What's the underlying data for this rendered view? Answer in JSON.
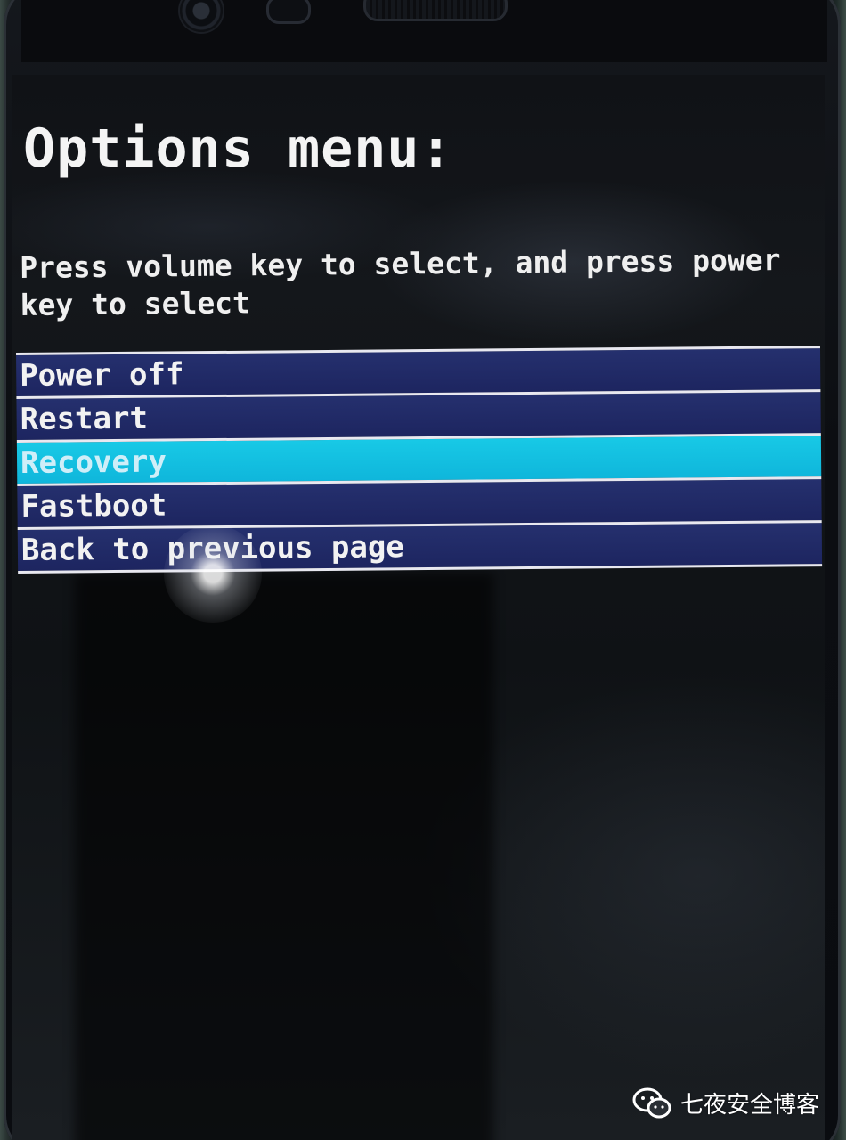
{
  "screen": {
    "title": "Options menu:",
    "instructions": "Press volume key to select, and press power key to select"
  },
  "menu": {
    "items": [
      {
        "label": "Power off"
      },
      {
        "label": "Restart"
      },
      {
        "label": "Recovery",
        "selected": true
      },
      {
        "label": "Fastboot"
      },
      {
        "label": "Back to previous page"
      }
    ]
  },
  "watermark": {
    "text": "七夜安全博客",
    "icon": "wechat-icon"
  },
  "colors": {
    "menu_item": "#1d2560",
    "menu_selected": "#0fb6db",
    "separator": "#e8e8f0",
    "text": "#f2f2f2",
    "background": "#101216"
  }
}
